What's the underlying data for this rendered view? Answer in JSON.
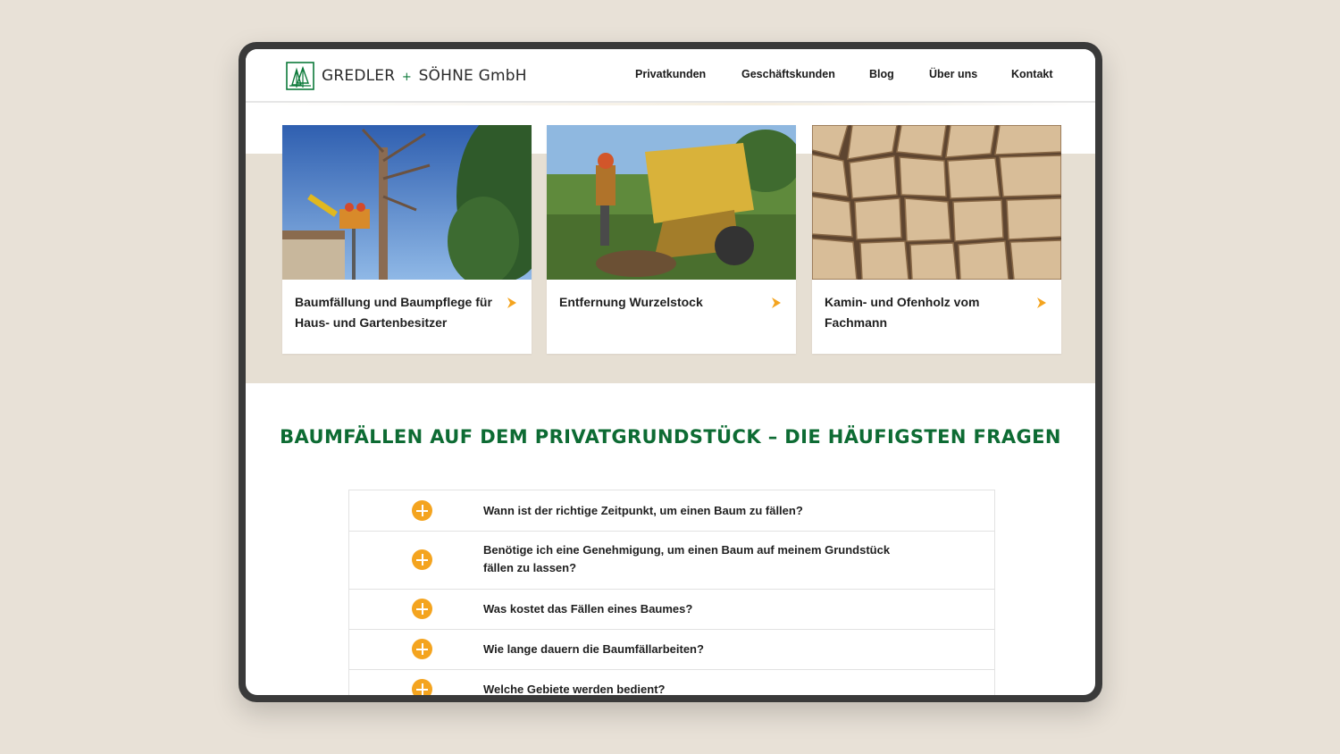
{
  "header": {
    "logo": {
      "name": "GREDLER",
      "plus": "+",
      "name2": "SÖHNE GmbH"
    },
    "nav": [
      "Privatkunden",
      "Geschäftskunden",
      "Blog",
      "Über uns",
      "Kontakt"
    ]
  },
  "cards": [
    {
      "title": "Baumfällung und Baumpflege für Haus- und Gartenbesitzer"
    },
    {
      "title": "Entfernung Wurzelstock"
    },
    {
      "title": "Kamin- und Ofenholz vom Fachmann"
    }
  ],
  "faq": {
    "title": "BAUMFÄLLEN AUF DEM PRIVATGRUNDSTÜCK – DIE HÄUFIGSTEN FRAGEN",
    "items": [
      "Wann ist der richtige Zeitpunkt, um einen Baum zu fällen?",
      "Benötige ich eine Genehmigung, um einen Baum auf meinem Grundstück fällen zu lassen?",
      "Was kostet das Fällen eines Baumes?",
      "Wie lange dauern die Baumfällarbeiten?",
      "Welche Gebiete werden bedient?"
    ]
  },
  "colors": {
    "brand_green": "#0d6b33",
    "accent_orange": "#f4a41f",
    "band_beige": "#e6dfd3"
  }
}
